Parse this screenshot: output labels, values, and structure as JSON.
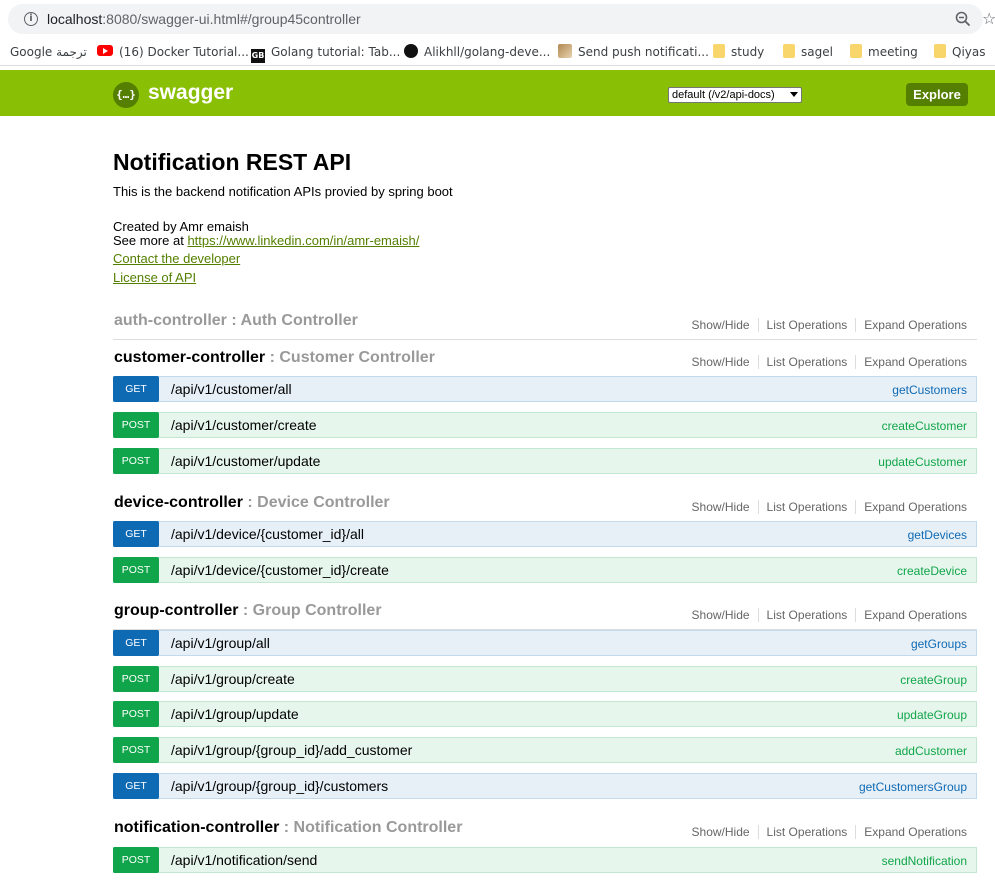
{
  "browser": {
    "url_host": "localhost",
    "url_rest": ":8080/swagger-ui.html#/group45controller",
    "bookmarks": [
      {
        "label": "Google ترجمة",
        "icon": "google-translate-icon"
      },
      {
        "label": "(16) Docker Tutorial...",
        "icon": "youtube-icon"
      },
      {
        "label": "Golang tutorial: Tab...",
        "icon": "gb-icon"
      },
      {
        "label": "Alikhll/golang-deve...",
        "icon": "github-icon"
      },
      {
        "label": "Send push notificati...",
        "icon": "page-icon"
      },
      {
        "label": "study",
        "icon": "folder-icon"
      },
      {
        "label": "sagel",
        "icon": "folder-icon"
      },
      {
        "label": "meeting",
        "icon": "folder-icon"
      },
      {
        "label": "Qiyas",
        "icon": "folder-icon"
      }
    ]
  },
  "header": {
    "logo_text": "swagger",
    "api_select_value": "default (/v2/api-docs)",
    "explore_label": "Explore"
  },
  "info": {
    "title": "Notification REST API",
    "description": "This is the backend notification APIs provied by spring boot",
    "created_by": "Created by Amr emaish",
    "see_more_prefix": "See more at ",
    "see_more_link": "https://www.linkedin.com/in/amr-emaish/",
    "contact_link": "Contact the developer",
    "license_link": "License of API"
  },
  "resource_actions": {
    "show_hide": "Show/Hide",
    "list_operations": "List Operations",
    "expand_operations": "Expand Operations"
  },
  "resources": [
    {
      "name": "auth-controller",
      "sep": " : ",
      "desc": "Auth Controller",
      "operations": []
    },
    {
      "name": "customer-controller",
      "sep": " : ",
      "desc": "Customer Controller",
      "operations": [
        {
          "method": "GET",
          "path": "/api/v1/customer/all",
          "nickname": "getCustomers"
        },
        {
          "method": "POST",
          "path": "/api/v1/customer/create",
          "nickname": "createCustomer"
        },
        {
          "method": "POST",
          "path": "/api/v1/customer/update",
          "nickname": "updateCustomer"
        }
      ]
    },
    {
      "name": "device-controller",
      "sep": " : ",
      "desc": "Device Controller",
      "operations": [
        {
          "method": "GET",
          "path": "/api/v1/device/{customer_id}/all",
          "nickname": "getDevices"
        },
        {
          "method": "POST",
          "path": "/api/v1/device/{customer_id}/create",
          "nickname": "createDevice"
        }
      ]
    },
    {
      "name": "group-controller",
      "sep": " : ",
      "desc": "Group Controller",
      "operations": [
        {
          "method": "GET",
          "path": "/api/v1/group/all",
          "nickname": "getGroups"
        },
        {
          "method": "POST",
          "path": "/api/v1/group/create",
          "nickname": "createGroup"
        },
        {
          "method": "POST",
          "path": "/api/v1/group/update",
          "nickname": "updateGroup"
        },
        {
          "method": "POST",
          "path": "/api/v1/group/{group_id}/add_customer",
          "nickname": "addCustomer"
        },
        {
          "method": "GET",
          "path": "/api/v1/group/{group_id}/customers",
          "nickname": "getCustomersGroup"
        }
      ]
    },
    {
      "name": "notification-controller",
      "sep": " : ",
      "desc": "Notification Controller",
      "operations": [
        {
          "method": "POST",
          "path": "/api/v1/notification/send",
          "nickname": "sendNotification"
        }
      ]
    }
  ],
  "colors": {
    "header_green": "#89bf04",
    "explore_green": "#547f00",
    "get_blue": "#0f6ab4",
    "post_green": "#10a54a"
  }
}
